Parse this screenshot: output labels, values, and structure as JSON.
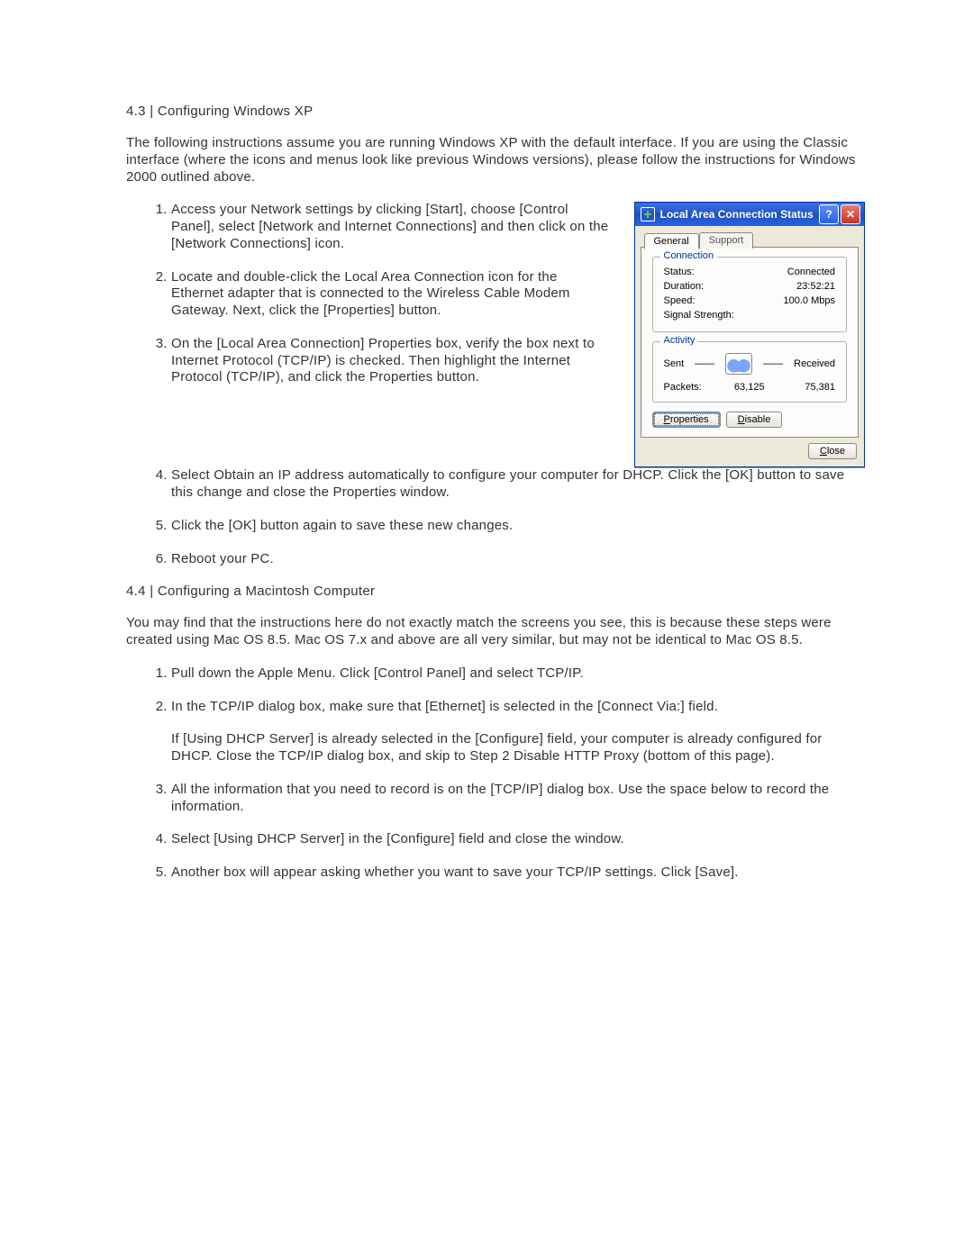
{
  "section43": {
    "heading": "4.3 |  Configuring Windows XP",
    "intro": "The following instructions assume you are running Windows XP with the default interface. If you are using the Classic interface (where the icons and menus look like previous Windows versions), please follow the instructions for Windows 2000 outlined above.",
    "steps_a": [
      "Access your Network settings by clicking [Start], choose [Control Panel], select [Network and Internet Connections] and then click on the [Network Connections] icon.",
      "Locate and double-click the Local Area Connection icon for the Ethernet adapter that is connected to the Wireless Cable Modem Gateway. Next, click the [Properties] button.",
      "On the [Local Area Connection] Properties box, verify the box next to Internet Protocol (TCP/IP) is checked. Then highlight the Internet Protocol (TCP/IP), and click the Properties button."
    ],
    "steps_b": [
      "Select Obtain an IP address automatically to configure your computer for DHCP. Click the [OK] button to save this change and close the Properties window.",
      "Click the [OK] button again to save these new changes.",
      "Reboot your PC."
    ]
  },
  "section44": {
    "heading": "4.4 |  Configuring a Macintosh Computer",
    "intro": "You may find that the instructions here do not exactly match the screens you see, this is because these steps were created using Mac OS 8.5.  Mac OS 7.x and above are all very similar, but may not be identical to Mac OS 8.5.",
    "steps": [
      "Pull down the Apple Menu. Click [Control Panel] and select TCP/IP.",
      "In the TCP/IP dialog box, make sure that [Ethernet] is selected in the [Connect Via:] field.",
      "All the information that you need to record is on the [TCP/IP] dialog box. Use the space below to record the information.",
      "Select [Using DHCP Server] in the [Configure] field and close the window.",
      "Another box will appear asking whether you want to save your TCP/IP settings. Click [Save]."
    ],
    "step2_note": "If [Using DHCP Server] is already selected in the [Configure] field, your computer is already configured for DHCP. Close the TCP/IP dialog box, and skip to Step 2 Disable HTTP Proxy (bottom of this page)."
  },
  "xp_dialog": {
    "title": "Local Area Connection Status",
    "help_glyph": "?",
    "close_glyph": "✕",
    "tabs": {
      "general": "General",
      "support": "Support"
    },
    "connection": {
      "legend": "Connection",
      "status_label": "Status:",
      "status_value": "Connected",
      "duration_label": "Duration:",
      "duration_value": "23:52:21",
      "speed_label": "Speed:",
      "speed_value": "100.0 Mbps",
      "signal_label": "Signal Strength:"
    },
    "activity": {
      "legend": "Activity",
      "sent": "Sent",
      "received": "Received",
      "packets_label": "Packets:",
      "sent_value": "63,125",
      "received_value": "75,381"
    },
    "buttons": {
      "properties": "Properties",
      "disable": "Disable",
      "close": "Close"
    }
  }
}
